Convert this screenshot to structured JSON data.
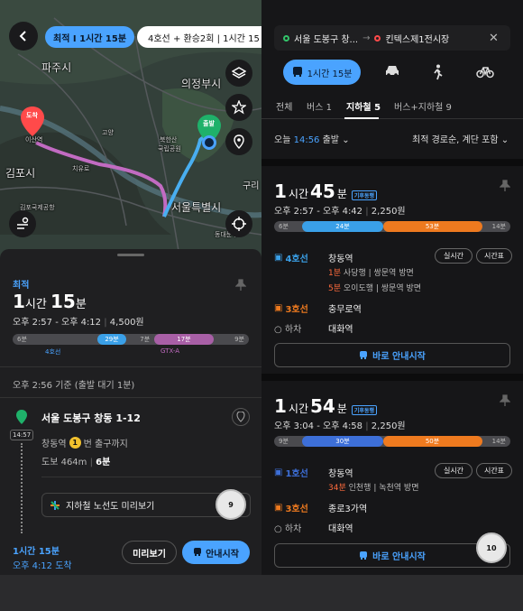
{
  "left": {
    "chips": {
      "best": "최적 I 1시간 15분",
      "alt": "4호선 + 환승2회 | 1시간 15"
    },
    "map_places": [
      "파주시",
      "의정부시",
      "도착",
      "이산역",
      "고양",
      "김포시",
      "치유로",
      "북한산",
      "국립공원",
      "출발",
      "서울특별시",
      "구리",
      "김포국제공항",
      "동대문구"
    ],
    "route": {
      "label": "최적",
      "hour": "1",
      "hour_unit": "시간",
      "minute": "15",
      "minute_unit": "분",
      "range": "오후 2:57 - 오후 4:12",
      "fare": "4,500원",
      "segments": [
        {
          "type": "walk",
          "text": "6분",
          "frac": 0.0
        },
        {
          "type": "subway",
          "text": "29분",
          "color": "#3aa0e8",
          "frac": 0.36
        },
        {
          "type": "walk",
          "text": "7분",
          "frac": 0.48
        },
        {
          "type": "train",
          "text": "17분",
          "color": "#a85fa6",
          "frac": 0.6
        },
        {
          "type": "walk",
          "text": "9분",
          "frac": 0.85
        }
      ],
      "line_labels": [
        "4호선",
        "GTX-A"
      ]
    },
    "basis": "오후 2:56 기준 (출발 대기 1분)",
    "start_place": "서울 도봉구 창동 1-12",
    "start_time": "14:57",
    "exit_station": "창동역",
    "exit_no": "1",
    "exit_suffix": "번 출구까지",
    "walk_prefix": "도보 464m",
    "walk_min": "6분",
    "line_map_btn": "지하철 노선도 미리보기",
    "float_num": "9",
    "footer": {
      "duration": "1시간 15분",
      "arrival": "오후 4:12 도착",
      "preview": "미리보기",
      "start": "안내시작"
    }
  },
  "right": {
    "search_from": "서울 도봉구 창...",
    "search_to": "킨텍스제1전시장",
    "mode_active": "1시간 15분",
    "tabs": [
      "전체",
      "버스 1",
      "지하철 5",
      "버스+지하철 9"
    ],
    "dep_today": "오늘",
    "dep_time": "14:56",
    "dep_suffix": "출발",
    "sort": "최적 경로순, 계단 포함",
    "cards": [
      {
        "hour": "1",
        "hour_unit": "시간",
        "minute": "45",
        "minute_unit": "분",
        "eco": "기후동행",
        "range": "오후 2:57 - 오후 4:42",
        "fare": "2,250원",
        "segments": [
          {
            "type": "walk",
            "text": "6분",
            "frac": 0.0
          },
          {
            "type": "subway",
            "text": "24분",
            "color": "#3aa0e8",
            "frac": 0.12
          },
          {
            "type": "subway2",
            "text": "53분",
            "color": "#ee7a1f",
            "frac": 0.46
          },
          {
            "type": "walk",
            "text": "14분",
            "frac": 0.88
          }
        ],
        "legs": [
          {
            "line": "4호선",
            "color": "#3aa0e8",
            "station": "창동역",
            "arrivals": [
              {
                "min": "1분",
                "dest": "사당행",
                "next": "쌍문역 방면"
              },
              {
                "min": "5분",
                "dest": "오이도행",
                "next": "쌍문역 방면"
              }
            ]
          },
          {
            "line": "3호선",
            "color": "#ee7a1f",
            "station": "충무로역",
            "arrivals": []
          }
        ],
        "realtime": "실시간",
        "timetable": "시간표",
        "alight_label": "하차",
        "alight_station": "대화역",
        "go": "바로 안내시작"
      },
      {
        "hour": "1",
        "hour_unit": "시간",
        "minute": "54",
        "minute_unit": "분",
        "eco": "기후동행",
        "range": "오후 3:04 - 오후 4:58",
        "fare": "2,250원",
        "segments": [
          {
            "type": "walk",
            "text": "9분",
            "frac": 0.0
          },
          {
            "type": "subway",
            "text": "30분",
            "color": "#3d6fd8",
            "frac": 0.12
          },
          {
            "type": "subway2",
            "text": "50분",
            "color": "#ee7a1f",
            "frac": 0.46
          },
          {
            "type": "walk",
            "text": "14분",
            "frac": 0.88
          }
        ],
        "legs": [
          {
            "line": "1호선",
            "color": "#3d6fd8",
            "station": "창동역",
            "arrivals": [
              {
                "min": "34분",
                "dest": "인천행",
                "next": "녹천역 방면"
              }
            ]
          },
          {
            "line": "3호선",
            "color": "#ee7a1f",
            "station": "종로3가역",
            "arrivals": []
          }
        ],
        "realtime": "실시간",
        "timetable": "시간표",
        "alight_label": "하차",
        "alight_station": "대화역",
        "go": "바로 안내시작"
      }
    ],
    "float_num": "10"
  }
}
